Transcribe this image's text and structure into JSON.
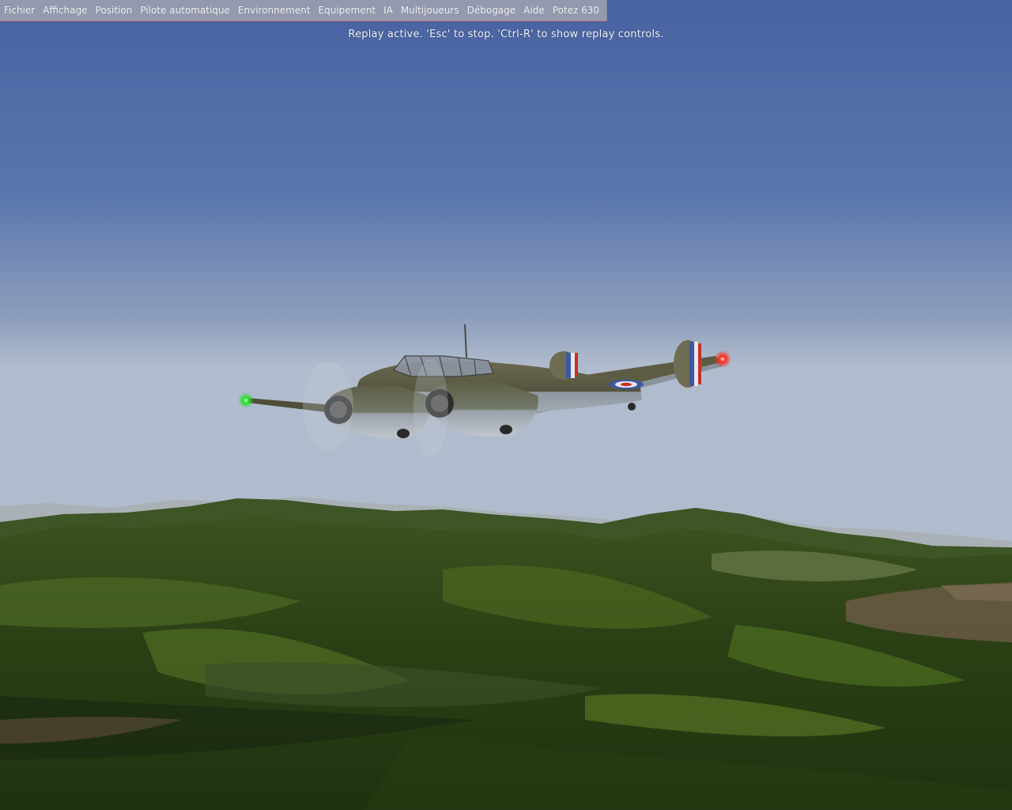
{
  "menubar": {
    "items": [
      "Fichier",
      "Affichage",
      "Position",
      "Pilote automatique",
      "Environnement",
      "Equipement",
      "IA",
      "Multijoueurs",
      "Débogage",
      "Aide",
      "Potez 630"
    ]
  },
  "hud": {
    "replay_message": "Replay active. 'Esc' to stop. 'Ctrl-R' to show replay controls."
  },
  "colors": {
    "sky_top": "#4a66a3",
    "sky_horizon": "#a8b6cc",
    "terrain_dark": "#1b2a12",
    "terrain_light": "#4c6a1c",
    "nav_light_left": "#22e022",
    "nav_light_right": "#ff2a1a"
  }
}
